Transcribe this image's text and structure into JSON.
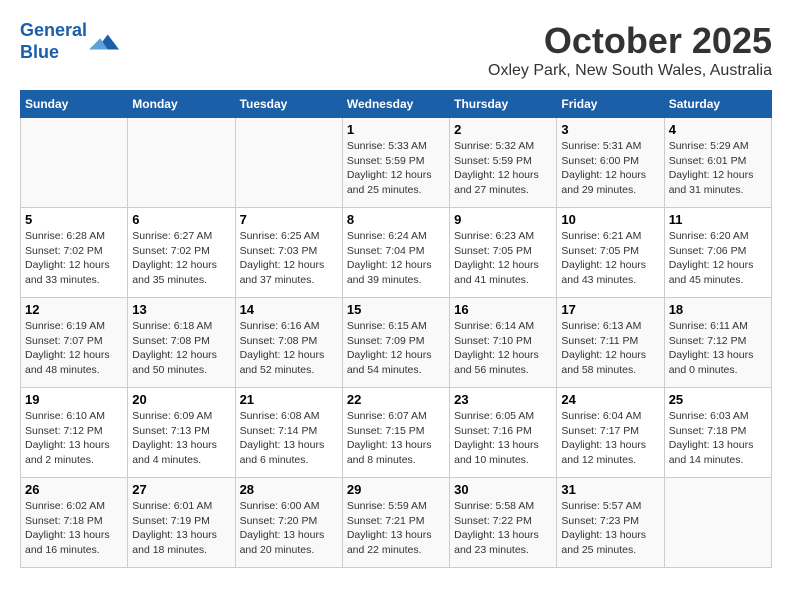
{
  "header": {
    "logo_line1": "General",
    "logo_line2": "Blue",
    "title": "October 2025",
    "subtitle": "Oxley Park, New South Wales, Australia"
  },
  "days_of_week": [
    "Sunday",
    "Monday",
    "Tuesday",
    "Wednesday",
    "Thursday",
    "Friday",
    "Saturday"
  ],
  "weeks": [
    [
      {
        "day": "",
        "info": ""
      },
      {
        "day": "",
        "info": ""
      },
      {
        "day": "",
        "info": ""
      },
      {
        "day": "1",
        "info": "Sunrise: 5:33 AM\nSunset: 5:59 PM\nDaylight: 12 hours\nand 25 minutes."
      },
      {
        "day": "2",
        "info": "Sunrise: 5:32 AM\nSunset: 5:59 PM\nDaylight: 12 hours\nand 27 minutes."
      },
      {
        "day": "3",
        "info": "Sunrise: 5:31 AM\nSunset: 6:00 PM\nDaylight: 12 hours\nand 29 minutes."
      },
      {
        "day": "4",
        "info": "Sunrise: 5:29 AM\nSunset: 6:01 PM\nDaylight: 12 hours\nand 31 minutes."
      }
    ],
    [
      {
        "day": "5",
        "info": "Sunrise: 6:28 AM\nSunset: 7:02 PM\nDaylight: 12 hours\nand 33 minutes."
      },
      {
        "day": "6",
        "info": "Sunrise: 6:27 AM\nSunset: 7:02 PM\nDaylight: 12 hours\nand 35 minutes."
      },
      {
        "day": "7",
        "info": "Sunrise: 6:25 AM\nSunset: 7:03 PM\nDaylight: 12 hours\nand 37 minutes."
      },
      {
        "day": "8",
        "info": "Sunrise: 6:24 AM\nSunset: 7:04 PM\nDaylight: 12 hours\nand 39 minutes."
      },
      {
        "day": "9",
        "info": "Sunrise: 6:23 AM\nSunset: 7:05 PM\nDaylight: 12 hours\nand 41 minutes."
      },
      {
        "day": "10",
        "info": "Sunrise: 6:21 AM\nSunset: 7:05 PM\nDaylight: 12 hours\nand 43 minutes."
      },
      {
        "day": "11",
        "info": "Sunrise: 6:20 AM\nSunset: 7:06 PM\nDaylight: 12 hours\nand 45 minutes."
      }
    ],
    [
      {
        "day": "12",
        "info": "Sunrise: 6:19 AM\nSunset: 7:07 PM\nDaylight: 12 hours\nand 48 minutes."
      },
      {
        "day": "13",
        "info": "Sunrise: 6:18 AM\nSunset: 7:08 PM\nDaylight: 12 hours\nand 50 minutes."
      },
      {
        "day": "14",
        "info": "Sunrise: 6:16 AM\nSunset: 7:08 PM\nDaylight: 12 hours\nand 52 minutes."
      },
      {
        "day": "15",
        "info": "Sunrise: 6:15 AM\nSunset: 7:09 PM\nDaylight: 12 hours\nand 54 minutes."
      },
      {
        "day": "16",
        "info": "Sunrise: 6:14 AM\nSunset: 7:10 PM\nDaylight: 12 hours\nand 56 minutes."
      },
      {
        "day": "17",
        "info": "Sunrise: 6:13 AM\nSunset: 7:11 PM\nDaylight: 12 hours\nand 58 minutes."
      },
      {
        "day": "18",
        "info": "Sunrise: 6:11 AM\nSunset: 7:12 PM\nDaylight: 13 hours\nand 0 minutes."
      }
    ],
    [
      {
        "day": "19",
        "info": "Sunrise: 6:10 AM\nSunset: 7:12 PM\nDaylight: 13 hours\nand 2 minutes."
      },
      {
        "day": "20",
        "info": "Sunrise: 6:09 AM\nSunset: 7:13 PM\nDaylight: 13 hours\nand 4 minutes."
      },
      {
        "day": "21",
        "info": "Sunrise: 6:08 AM\nSunset: 7:14 PM\nDaylight: 13 hours\nand 6 minutes."
      },
      {
        "day": "22",
        "info": "Sunrise: 6:07 AM\nSunset: 7:15 PM\nDaylight: 13 hours\nand 8 minutes."
      },
      {
        "day": "23",
        "info": "Sunrise: 6:05 AM\nSunset: 7:16 PM\nDaylight: 13 hours\nand 10 minutes."
      },
      {
        "day": "24",
        "info": "Sunrise: 6:04 AM\nSunset: 7:17 PM\nDaylight: 13 hours\nand 12 minutes."
      },
      {
        "day": "25",
        "info": "Sunrise: 6:03 AM\nSunset: 7:18 PM\nDaylight: 13 hours\nand 14 minutes."
      }
    ],
    [
      {
        "day": "26",
        "info": "Sunrise: 6:02 AM\nSunset: 7:18 PM\nDaylight: 13 hours\nand 16 minutes."
      },
      {
        "day": "27",
        "info": "Sunrise: 6:01 AM\nSunset: 7:19 PM\nDaylight: 13 hours\nand 18 minutes."
      },
      {
        "day": "28",
        "info": "Sunrise: 6:00 AM\nSunset: 7:20 PM\nDaylight: 13 hours\nand 20 minutes."
      },
      {
        "day": "29",
        "info": "Sunrise: 5:59 AM\nSunset: 7:21 PM\nDaylight: 13 hours\nand 22 minutes."
      },
      {
        "day": "30",
        "info": "Sunrise: 5:58 AM\nSunset: 7:22 PM\nDaylight: 13 hours\nand 23 minutes."
      },
      {
        "day": "31",
        "info": "Sunrise: 5:57 AM\nSunset: 7:23 PM\nDaylight: 13 hours\nand 25 minutes."
      },
      {
        "day": "",
        "info": ""
      }
    ]
  ]
}
